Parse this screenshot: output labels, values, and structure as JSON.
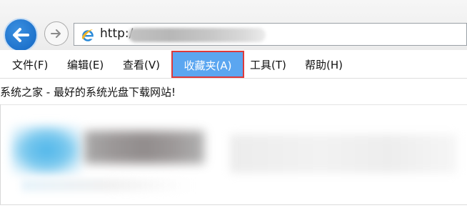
{
  "nav": {
    "address_text": "http:/"
  },
  "menu": {
    "items": [
      {
        "label": "文件(F)"
      },
      {
        "label": "编辑(E)"
      },
      {
        "label": "查看(V)"
      },
      {
        "label": "收藏夹(A)",
        "highlighted": true
      },
      {
        "label": "工具(T)"
      },
      {
        "label": "帮助(H)"
      }
    ]
  },
  "page": {
    "title": "系统之家 - 最好的系统光盘下载网站!"
  },
  "colors": {
    "menu_highlight_bg": "#5ba6f0",
    "menu_highlight_border": "#de3a3a",
    "back_button": "#1f73cc"
  }
}
